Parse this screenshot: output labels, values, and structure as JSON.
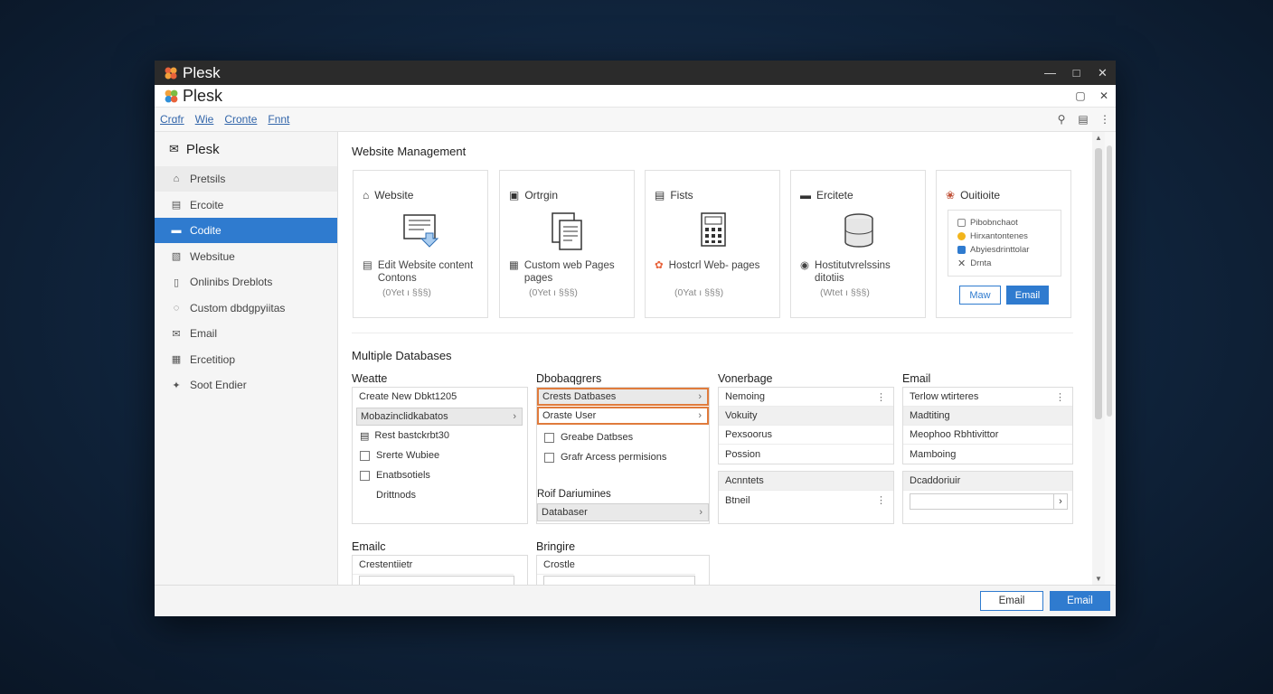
{
  "window": {
    "title": "Plesk",
    "app_title": "Plesk",
    "menu": [
      "Crɑfr",
      "Wie",
      "Cronte",
      "Fnnt"
    ]
  },
  "sidebar": {
    "header": "Plesk",
    "items": [
      {
        "label": "Pretsils",
        "icon": "home-icon"
      },
      {
        "label": "Ercoite",
        "icon": "document-icon"
      },
      {
        "label": "Codite",
        "icon": "folder-icon"
      },
      {
        "label": "Websitue",
        "icon": "database-icon"
      },
      {
        "label": "Onlinibs Dreblots",
        "icon": "page-icon"
      },
      {
        "label": "Custom dbdgpyiitas",
        "icon": "users-icon"
      },
      {
        "label": "Email",
        "icon": "mail-icon"
      },
      {
        "label": "Ercetitiop",
        "icon": "grid-icon"
      },
      {
        "label": "Soot Endier",
        "icon": "puzzle-icon"
      }
    ]
  },
  "main": {
    "section1_title": "Website Management",
    "cards": [
      {
        "title": "Website",
        "desc": "Edit Website content Contons",
        "sub": "(0Yet ı §§§)"
      },
      {
        "title": "Ortrgin",
        "desc": "Custom web Pages pages",
        "sub": "(0Yet ı §§§)"
      },
      {
        "title": "Fists",
        "desc": "Hostcrl Web- pages",
        "sub": "(0Yat ı §§§)"
      },
      {
        "title": "Ercitete",
        "desc": "Hostitutvrelssins ditotiis",
        "sub": "(Wtet ı §§§)"
      },
      {
        "title": "Ouitioite",
        "box": [
          "Pibobnchaot",
          "Hirxantontenes",
          "Abyiesdrinttolar",
          "Drnta"
        ],
        "btn1": "Maw",
        "btn2": "Email"
      }
    ],
    "section2_title": "Multiple Databases",
    "col1": {
      "title": "Weatte",
      "rows": [
        "Create New Dbkt1205",
        "Mobazinclidkabatos",
        "Rest bastckrbt30",
        "Srerte Wubiee",
        "Enatbsotiels",
        "Drittnods"
      ]
    },
    "col2": {
      "title": "Dbobaqgrers",
      "rows": [
        "Crests Datbases",
        "Oraste User",
        "Greabe Datbses",
        "Grafr Arcess permisions"
      ],
      "sub_title": "Roif Dariumines",
      "sub_row": "Databaser"
    },
    "col3": {
      "title": "Vonerbage",
      "rows": [
        "Nemoing",
        "Vokuity",
        "Pexsoorus",
        "Possion"
      ],
      "box2_head": "Acnntets",
      "box2_row": "Btneil"
    },
    "col4": {
      "title": "Email",
      "rows": [
        "Terlow wtirteres",
        "Madtiting",
        "Meophoo Rbhtivittor",
        "Mamboing"
      ],
      "box2_head": "Dcaddoriuir"
    },
    "bottom_left_title": "Emailc",
    "bottom_left_row": "Crestentiietr",
    "bottom_mid_title": "Bringire",
    "bottom_mid_row": "Crostle"
  },
  "footer": {
    "btn_secondary": "Email",
    "btn_primary": "Email"
  },
  "colors": {
    "accent": "#2f7bcf",
    "highlight": "#e07b3c"
  }
}
